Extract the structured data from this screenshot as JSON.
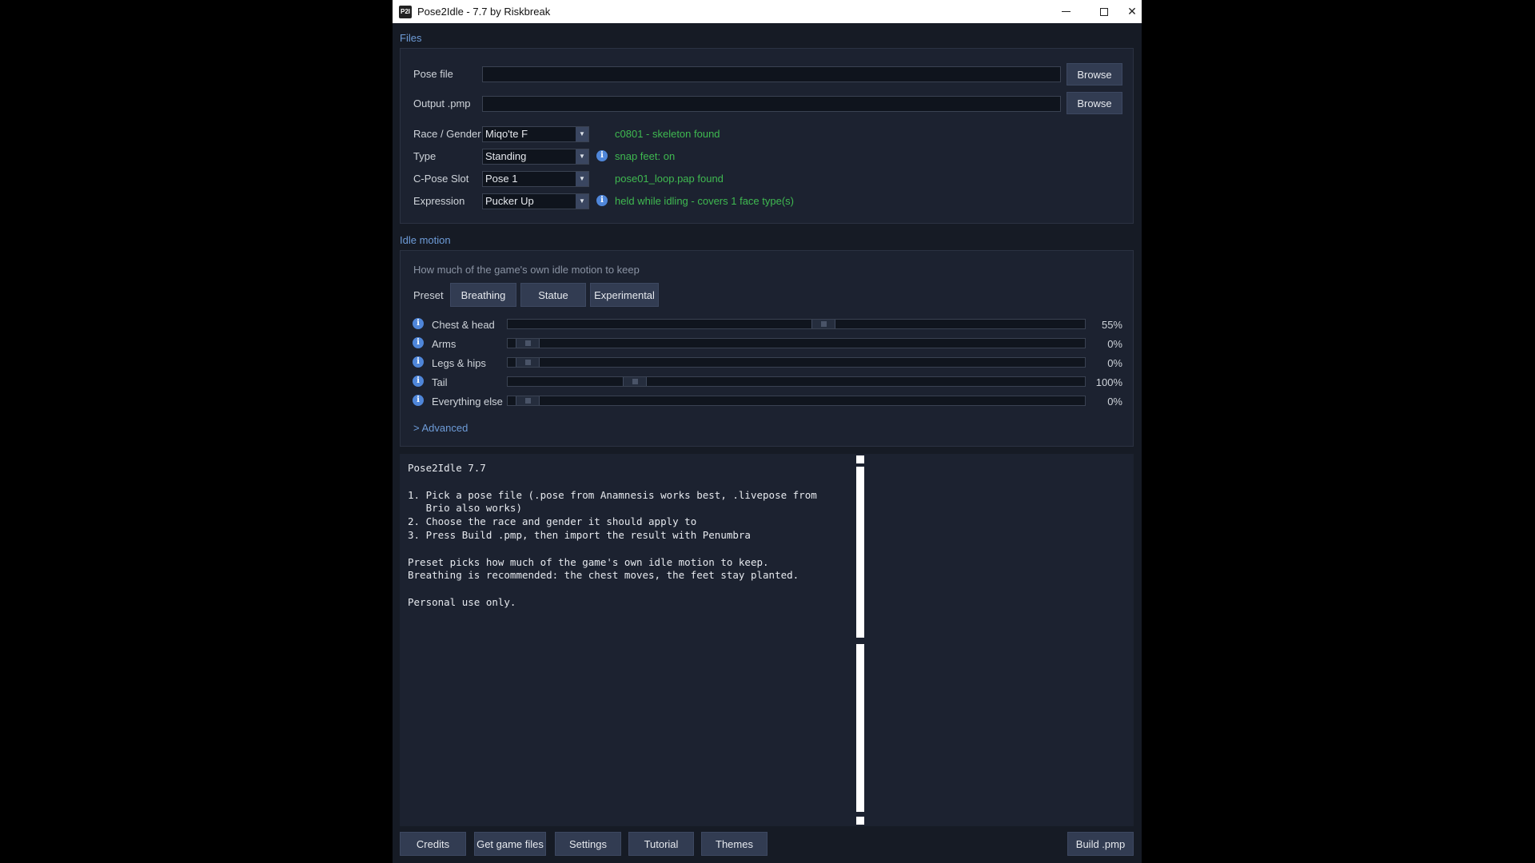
{
  "window": {
    "title": "Pose2Idle - 7.7 by Riskbreak",
    "icon_text": "P2I"
  },
  "files": {
    "section_title": "Files",
    "pose_file_label": "Pose file",
    "pose_file_value": "",
    "output_label": "Output .pmp",
    "output_value": "",
    "browse_label": "Browse",
    "race_label": "Race / Gender",
    "race_value": "Miqo'te F",
    "race_status": "c0801 - skeleton found",
    "type_label": "Type",
    "type_value": "Standing",
    "type_status": "snap feet: on",
    "cpose_label": "C-Pose Slot",
    "cpose_value": "Pose 1",
    "cpose_status": "pose01_loop.pap found",
    "expression_label": "Expression",
    "expression_value": "Pucker Up",
    "expression_status": "held while idling - covers 1 face type(s)"
  },
  "idle": {
    "section_title": "Idle motion",
    "hint": "How much of the game's own idle motion to keep",
    "preset_label": "Preset",
    "presets": [
      "Breathing",
      "Statue",
      "Experimental"
    ],
    "sliders": [
      {
        "label": "Chest & head",
        "value": 55,
        "display": "55%"
      },
      {
        "label": "Arms",
        "value": 0,
        "display": "0%"
      },
      {
        "label": "Legs & hips",
        "value": 0,
        "display": "0%"
      },
      {
        "label": "Tail",
        "value": 20,
        "display": "100%"
      },
      {
        "label": "Everything else",
        "value": 0,
        "display": "0%"
      }
    ],
    "advanced_label": "> Advanced"
  },
  "log": {
    "text": "Pose2Idle 7.7\n\n1. Pick a pose file (.pose from Anamnesis works best, .livepose from\n   Brio also works)\n2. Choose the race and gender it should apply to\n3. Press Build .pmp, then import the result with Penumbra\n\nPreset picks how much of the game's own idle motion to keep.\nBreathing is recommended: the chest moves, the feet stay planted.\n\nPersonal use only."
  },
  "bottom": {
    "credits": "Credits",
    "get_game_files": "Get game files",
    "settings": "Settings",
    "tutorial": "Tutorial",
    "themes": "Themes",
    "build": "Build .pmp"
  },
  "icons": {
    "info": "info-icon",
    "dropdown": "chevron-down-icon"
  }
}
